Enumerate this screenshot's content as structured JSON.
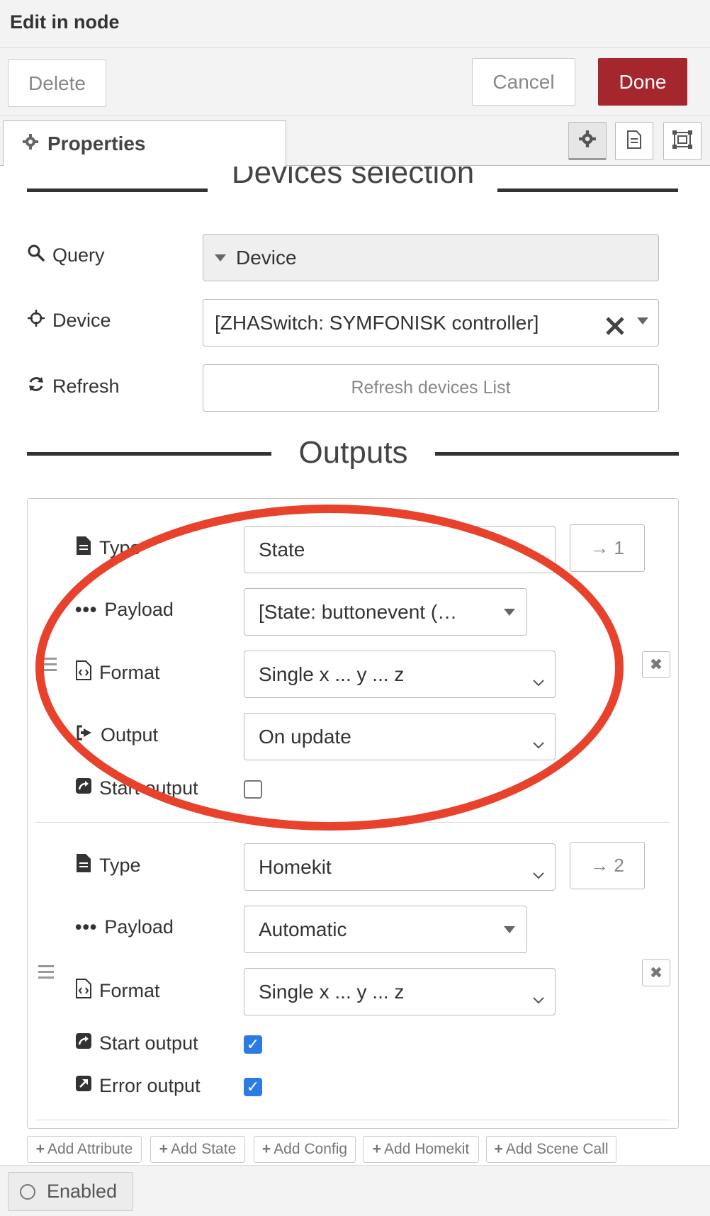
{
  "header": {
    "title": "Edit in node"
  },
  "toolbar": {
    "delete_label": "Delete",
    "cancel_label": "Cancel",
    "done_label": "Done"
  },
  "tabs": {
    "properties_label": "Properties"
  },
  "devices_section": {
    "title": "Devices selection",
    "query_label": "Query",
    "query_value": "Device",
    "device_label": "Device",
    "device_value": "[ZHASwitch: SYMFONISK controller]",
    "refresh_label": "Refresh",
    "refresh_button": "Refresh devices List"
  },
  "outputs_section": {
    "title": "Outputs",
    "outputs": [
      {
        "type_label": "Type",
        "type_value": "State",
        "port": "→ 1",
        "payload_label": "Payload",
        "payload_value": "[State: buttonevent (…",
        "format_label": "Format",
        "format_value": "Single x ... y ... z",
        "output_label": "Output",
        "output_value": "On update",
        "start_label": "Start output",
        "start_checked": false
      },
      {
        "type_label": "Type",
        "type_value": "Homekit",
        "port": "→ 2",
        "payload_label": "Payload",
        "payload_value": "Automatic",
        "format_label": "Format",
        "format_value": "Single x ... y ... z",
        "start_label": "Start output",
        "start_checked": true,
        "error_label": "Error output",
        "error_checked": true
      }
    ]
  },
  "add_buttons": [
    "Add Attribute",
    "Add State",
    "Add Config",
    "Add Homekit",
    "Add Scene Call"
  ],
  "footer": {
    "enabled_label": "Enabled"
  },
  "colors": {
    "done": "#a6262d",
    "highlight": "#e8412c",
    "checkbox": "#2c7be5"
  }
}
